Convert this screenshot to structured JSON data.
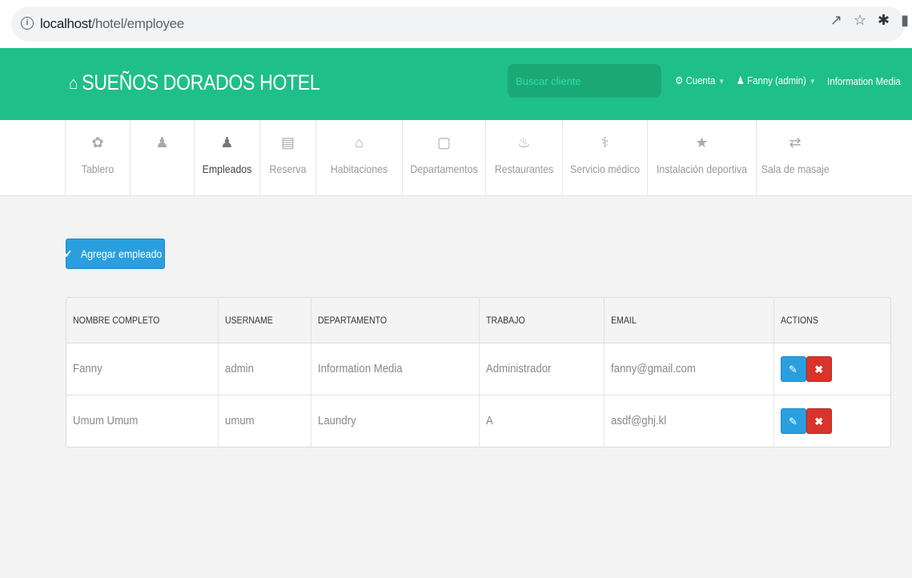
{
  "browser": {
    "url_host": "localhost",
    "url_path": "/hotel/employee"
  },
  "navbar": {
    "brand": "SUEÑOS DORADOS HOTEL",
    "search_placeholder": "Buscar cliente",
    "account_label": "Cuenta",
    "user_label": "Fanny (admin)",
    "department_label": "Information Media"
  },
  "menu": {
    "items": [
      {
        "label": "Tablero",
        "icon": "palette-icon"
      },
      {
        "label": "",
        "icon": "user-icon"
      },
      {
        "label": "Empleados",
        "icon": "user-icon"
      },
      {
        "label": "Reserva",
        "icon": "list-icon"
      },
      {
        "label": "Habitaciones",
        "icon": "home-icon"
      },
      {
        "label": "Departamentos",
        "icon": "file-icon"
      },
      {
        "label": "Restaurantes",
        "icon": "fire-icon"
      },
      {
        "label": "Servicio médico",
        "icon": "user-md-icon"
      },
      {
        "label": "Instalación deportiva",
        "icon": "trophy-icon"
      },
      {
        "label": "Sala de masaje",
        "icon": "retweet-icon"
      }
    ]
  },
  "add_button": {
    "label": "Agregar empleado"
  },
  "table": {
    "headers": [
      "NOMBRE COMPLETO",
      "USERNAME",
      "DEPARTAMENTO",
      "TRABAJO",
      "EMAIL",
      "ACTIONS"
    ],
    "rows": [
      [
        "Fanny",
        "admin",
        "Information Media",
        "Administrador",
        "fanny@gmail.com"
      ],
      [
        "Umum Umum",
        "umum",
        "Laundry",
        "A",
        "asdf@ghj.kl"
      ]
    ]
  },
  "colors": {
    "navbar": "#1fbf8a",
    "primary_button": "#2a9fe0",
    "danger_button": "#d9342b"
  }
}
